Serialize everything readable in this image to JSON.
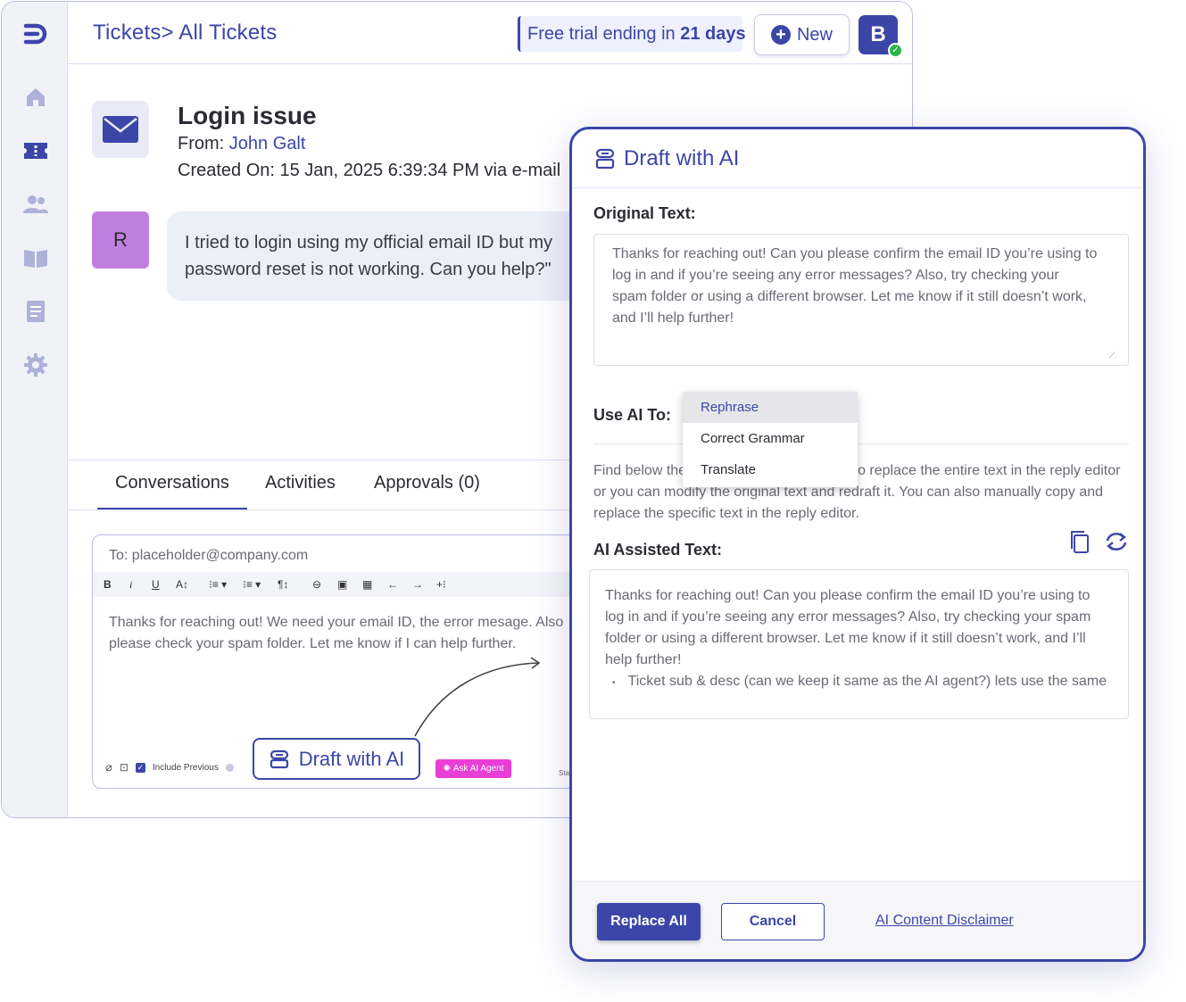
{
  "header": {
    "breadcrumb": "Tickets> All Tickets",
    "trial_prefix": "Free trial ending in ",
    "trial_days": "21 days",
    "new_label": "New",
    "user_initial": "B"
  },
  "sidebar": {
    "items": [
      "home-icon",
      "ticket-icon",
      "users-icon",
      "book-icon",
      "document-icon",
      "settings-icon"
    ],
    "active": "ticket-icon"
  },
  "ticket": {
    "title": "Login issue",
    "from_label": "From: ",
    "from_name": "John Galt",
    "created": "Created On: 15 Jan, 2025 6:39:34 PM via e-mail",
    "requester_initial": "R",
    "message": "I tried to login using my official email ID but my password reset is not working. Can you help?\""
  },
  "tabs": [
    {
      "label": "Conversations",
      "active": true
    },
    {
      "label": "Activities",
      "active": false
    },
    {
      "label": "Approvals (0)",
      "active": false
    }
  ],
  "editor": {
    "to": "To: placeholder@company.com",
    "body": "Thanks for reaching out! We need your email ID, the error mesage. Also please check your spam folder. Let me know if I can help further.",
    "include_previous": "Include Previous",
    "ask_agent": "Ask AI Agent",
    "status_stub": "Sta",
    "draft_button": "Draft with AI"
  },
  "panel": {
    "title": "Draft with AI",
    "original_label": "Original Text:",
    "original_text": "Thanks for reaching out! Can you please confirm the email ID you’re using to log in and if you’re seeing any error messages? Also, try checking your spam folder or using a different browser. Let me know if it still doesn’t work, and I’ll help further!",
    "use_ai_label": "Use AI To:",
    "options": [
      "Rephrase",
      "Correct Grammar",
      "Translate"
    ],
    "selected_option": "Rephrase",
    "hint_start": "Find below the",
    "hint_mid": "o replace the entire text in the reply editor",
    "hint_rest": "or you can modify the original text and redraft it. You can also manually copy and replace the specific text in the reply editor.",
    "assisted_label": "AI Assisted Text:",
    "assisted_text": "Thanks for reaching out! Can you please confirm the email ID you’re using to log in and if you’re seeing any error messages? Also, try checking your spam folder or using a different browser. Let me know if it still doesn’t work, and I’ll help further!",
    "assisted_bullet": "Ticket sub & desc (can we keep it same as the AI agent?) lets use the same",
    "replace_all": "Replace All",
    "cancel": "Cancel",
    "disclaimer": "AI Content Disclaimer"
  },
  "colors": {
    "accent": "#3b46a8",
    "requester_avatar": "#c07fe0",
    "ai_agent": "#e83ed6",
    "online": "#2db34a"
  }
}
